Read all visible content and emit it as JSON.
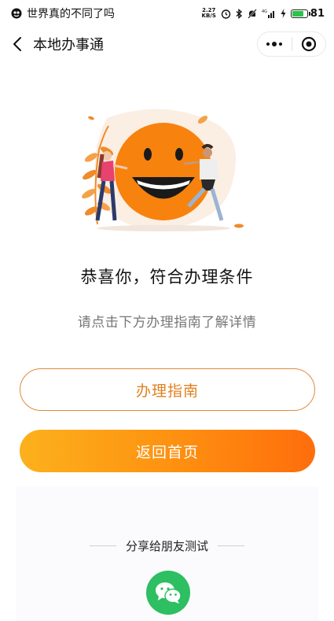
{
  "status_bar": {
    "carrier_text": "世界真的不同了吗",
    "speed_value": "2.27",
    "speed_unit": "KB/S",
    "battery": "81",
    "battery_level": 0.81,
    "icons": [
      "alarm-icon",
      "bluetooth-icon",
      "mute-icon",
      "signal-icon",
      "charging-icon"
    ]
  },
  "nav": {
    "title": "本地办事通",
    "back_icon": "chevron-left-icon",
    "more_icon": "more-dots-icon",
    "close_icon": "target-close-icon"
  },
  "main": {
    "headline": "恭喜你，符合办理条件",
    "subline": "请点击下方办理指南了解详情",
    "guide_button": "办理指南",
    "home_button": "返回首页"
  },
  "share": {
    "label": "分享给朋友测试",
    "icon": "wechat-icon"
  },
  "colors": {
    "accent": "#fe8f10",
    "accent_border": "#e08a3a",
    "wechat": "#2dbf62"
  }
}
